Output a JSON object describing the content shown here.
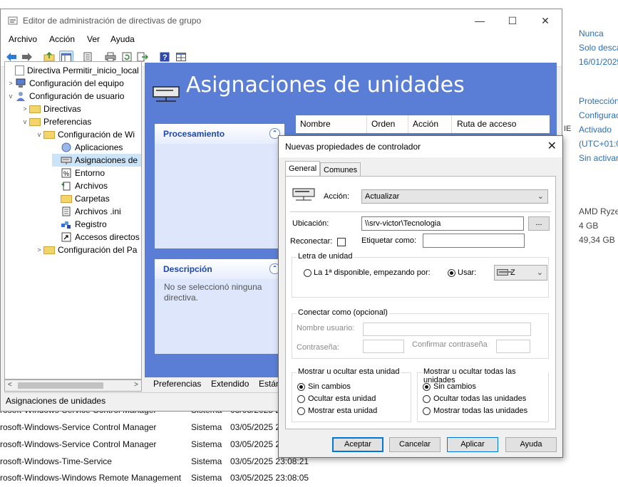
{
  "window": {
    "title": "Editor de administración de directivas de grupo",
    "minimize": "—",
    "maximize": "☐",
    "close": "✕"
  },
  "menu": [
    "Archivo",
    "Acción",
    "Ver",
    "Ayuda"
  ],
  "toolbar": [
    "back-icon",
    "forward-icon",
    "up-folder-icon",
    "show-tree-icon",
    "properties-icon",
    "print-icon",
    "refresh-icon",
    "export-icon",
    "help-icon",
    "view-icon"
  ],
  "tree": {
    "root": "Directiva Permitir_inicio_local [\\",
    "equipo": "Configuración del equipo",
    "usuario": "Configuración de usuario",
    "directivas": "Directivas",
    "preferencias": "Preferencias",
    "config_windows": "Configuración de Wi",
    "items": [
      "Aplicaciones",
      "Asignaciones de",
      "Entorno",
      "Archivos",
      "Carpetas",
      "Archivos .ini",
      "Registro",
      "Accesos directos"
    ],
    "config_panel": "Configuración del Pa"
  },
  "pane": {
    "title": "Asignaciones de unidades",
    "procesamiento": "Procesamiento",
    "descripcion": "Descripción",
    "descripcion_text": "No se seleccionó ninguna directiva.",
    "columns": [
      "Nombre",
      "Orden",
      "Acción",
      "Ruta de acceso"
    ]
  },
  "bottom_tabs": [
    "Preferencias",
    "Extendido",
    "Están"
  ],
  "status": "Asignaciones de unidades",
  "dialog": {
    "title": "Nuevas propiedades de controlador",
    "close": "✕",
    "tabs": [
      "General",
      "Comunes"
    ],
    "accion_label": "Acción:",
    "accion_value": "Actualizar",
    "ubicacion_label": "Ubicación:",
    "ubicacion_value": "\\\\srv-victor\\Tecnologia",
    "browse": "...",
    "reconectar_label": "Reconectar:",
    "etiquetar_label": "Etiquetar como:",
    "letra_group": "Letra de unidad",
    "primera_disponible": "La 1ª disponible, empezando por:",
    "usar": "Usar:",
    "drive_letter": "Z",
    "conectar_group": "Conectar como (opcional)",
    "usuario_label": "Nombre usuario:",
    "password_label": "Contraseña:",
    "confirm_label": "Confirmar contraseña",
    "mostrar_unidad_group": "Mostrar u ocultar esta unidad",
    "mostrar_todas_group": "Mostrar u ocultar todas las unidades",
    "unidad_opts": [
      "Sin cambios",
      "Ocultar esta unidad",
      "Mostrar esta unidad"
    ],
    "todas_opts": [
      "Sin cambios",
      "Ocultar todas las unidades",
      "Mostrar todas las unidades"
    ],
    "buttons": {
      "aceptar": "Aceptar",
      "cancelar": "Cancelar",
      "aplicar": "Aplicar",
      "ayuda": "Ayuda"
    }
  },
  "background": {
    "right_values": [
      "Nunca",
      "Solo descar",
      "16/01/2025",
      "Protección",
      "Configurac",
      "Activado",
      "(UTC+01:00",
      "Sin activar"
    ],
    "right_hw": [
      "AMD Ryzen",
      "4 GB",
      "49,34 GB"
    ],
    "ie_label": "IE",
    "rows": [
      {
        "name": "rosoft-Windows-Service Control Manager",
        "src": "Sistema",
        "date": "03/05/2025 2"
      },
      {
        "name": "rosoft-Windows-Service Control Manager",
        "src": "Sistema",
        "date": "03/05/2025 2"
      },
      {
        "name": "rosoft-Windows-Service Control Manager",
        "src": "Sistema",
        "date": "03/05/2025 2"
      },
      {
        "name": "rosoft-Windows-Time-Service",
        "src": "Sistema",
        "date": "03/05/2025 23:08:21"
      },
      {
        "name": "rosoft-Windows-Windows Remote Management",
        "src": "Sistema",
        "date": "03/05/2025 23:08:05"
      }
    ]
  },
  "colors": {
    "pane_bg": "#5a7ed6",
    "card_bg": "#dde6fb",
    "selection": "#cce4f7",
    "accent": "#0078d7"
  }
}
